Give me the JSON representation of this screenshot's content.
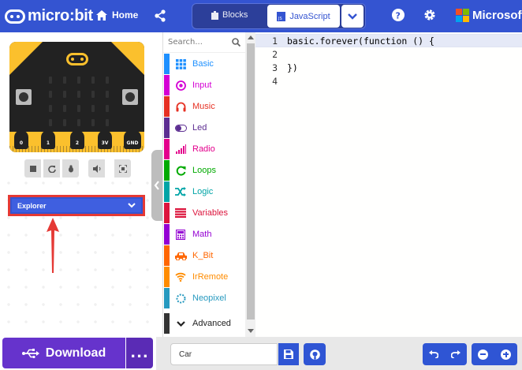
{
  "header": {
    "logo_text": "micro:bit",
    "home_label": "Home",
    "toggle": {
      "blocks_label": "Blocks",
      "js_label": "JavaScript",
      "active": "JavaScript"
    },
    "brand_text": "Microsoft",
    "colors": {
      "header": "#3454d1"
    }
  },
  "simulator": {
    "pins": [
      "0",
      "1",
      "2",
      "3V",
      "GND"
    ],
    "tools": [
      "stop-icon",
      "restart-icon",
      "debug-icon",
      "mute-icon",
      "fullscreen-icon"
    ],
    "explorer_label": "Explorer"
  },
  "toolbox": {
    "search_placeholder": "Search...",
    "categories": [
      {
        "label": "Basic",
        "color": "#1e90ff",
        "icon": "grid-icon"
      },
      {
        "label": "Input",
        "color": "#d400d4",
        "icon": "target-icon"
      },
      {
        "label": "Music",
        "color": "#e63022",
        "icon": "headphones-icon"
      },
      {
        "label": "Led",
        "color": "#5c2d91",
        "icon": "toggle-icon"
      },
      {
        "label": "Radio",
        "color": "#e3008c",
        "icon": "signal-icon"
      },
      {
        "label": "Loops",
        "color": "#00aa00",
        "icon": "loop-icon"
      },
      {
        "label": "Logic",
        "color": "#00a4a6",
        "icon": "shuffle-icon"
      },
      {
        "label": "Variables",
        "color": "#dc143c",
        "icon": "list-icon"
      },
      {
        "label": "Math",
        "color": "#9400d3",
        "icon": "calculator-icon"
      },
      {
        "label": "K_Bit",
        "color": "#ff6600",
        "icon": "car-icon"
      },
      {
        "label": "IrRemote",
        "color": "#ff8c00",
        "icon": "wifi-icon"
      },
      {
        "label": "Neopixel",
        "color": "#2699bf",
        "icon": "ring-icon"
      }
    ],
    "advanced_label": "Advanced"
  },
  "editor": {
    "lines": [
      {
        "num": "1",
        "pre": "basic.forever(",
        "kw": "function",
        "post": " () {"
      },
      {
        "num": "2",
        "pre": "",
        "kw": "",
        "post": ""
      },
      {
        "num": "3",
        "pre": "})",
        "kw": "",
        "post": ""
      },
      {
        "num": "4",
        "pre": "",
        "kw": "",
        "post": ""
      }
    ]
  },
  "bottom": {
    "download_label": "Download",
    "more_label": "...",
    "project_name": "Car"
  }
}
